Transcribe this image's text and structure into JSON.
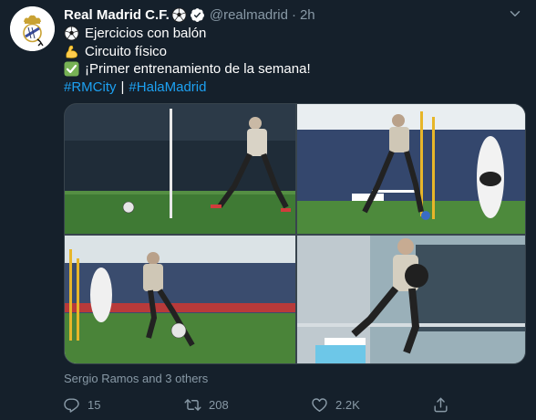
{
  "tweet": {
    "display_name": "Real Madrid C.F.",
    "name_emoji": "soccer-ball-icon",
    "verified_icon": "verified-badge-icon",
    "handle": "@realmadrid",
    "separator": "·",
    "time": "2h",
    "lines": [
      {
        "icon": "soccer-ball-icon",
        "text": "Ejercicios con balón"
      },
      {
        "icon": "flexed-biceps-icon",
        "text": "Circuito físico"
      },
      {
        "icon": "check-mark-button-icon",
        "text": "¡Primer entrenamiento de la semana!"
      }
    ],
    "hashtags": [
      "#RMCity",
      "#HalaMadrid"
    ],
    "hashtag_separator": "|",
    "tagged_text": "Sergio Ramos and 3 others",
    "actions": {
      "reply_count": "15",
      "retweet_count": "208",
      "like_count": "2.2K"
    },
    "photos": [
      {
        "name": "photo-player-kicking-ball-on-pitch"
      },
      {
        "name": "photo-player-dribbling-near-poles"
      },
      {
        "name": "photo-player-striking-ball"
      },
      {
        "name": "photo-player-carrying-medicine-ball"
      }
    ]
  },
  "colors": {
    "background": "#15202b",
    "text": "#ffffff",
    "secondary": "#8899a6",
    "link": "#1da1f2",
    "border": "#38444d"
  }
}
